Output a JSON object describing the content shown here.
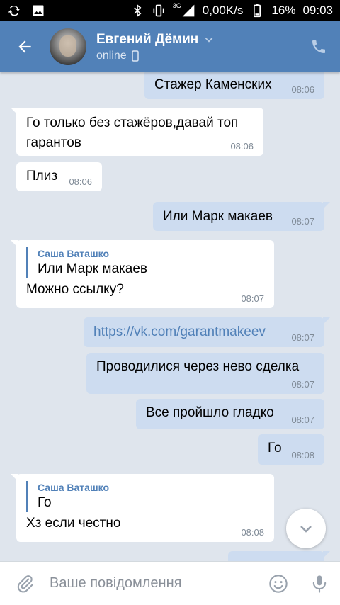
{
  "statusbar": {
    "network": "3G",
    "speed": "0,00K/s",
    "battery": "16%",
    "time": "09:03"
  },
  "header": {
    "title": "Евгений Дёмин",
    "status": "online"
  },
  "messages": [
    {
      "text": "Стажер Каменских",
      "time": "08:06"
    },
    {
      "text": "Го только без стажёров,давай топ гарантов",
      "time": "08:06"
    },
    {
      "text": "Плиз",
      "time": "08:06"
    },
    {
      "text": "Или Марк макаев",
      "time": "08:07"
    },
    {
      "reply_name": "Саша Ваташко",
      "reply_text": "Или Марк макаев",
      "text": "Можно ссылку?",
      "time": "08:07"
    },
    {
      "text": "https://vk.com/garantmakeev",
      "time": "08:07"
    },
    {
      "text": "Проводилися через нево сделка",
      "time": "08:07"
    },
    {
      "text": "Все пройшло гладко",
      "time": "08:07"
    },
    {
      "text": "Го",
      "time": "08:08"
    },
    {
      "reply_name": "Саша Ваташко",
      "reply_text": "Го",
      "text": "Хз если честно",
      "time": "08:08"
    }
  ],
  "composer": {
    "placeholder": "Ваше повідомлення"
  },
  "icons": {
    "back": "arrow-left-icon",
    "phone": "phone-icon",
    "attach": "paperclip-icon",
    "emoji": "smile-icon",
    "mic": "microphone-icon",
    "scroll": "chevron-down-icon"
  },
  "colors": {
    "header": "#5181b8",
    "outgoing": "#cddcf0",
    "incoming": "#ffffff",
    "background": "#dfe5ed"
  }
}
